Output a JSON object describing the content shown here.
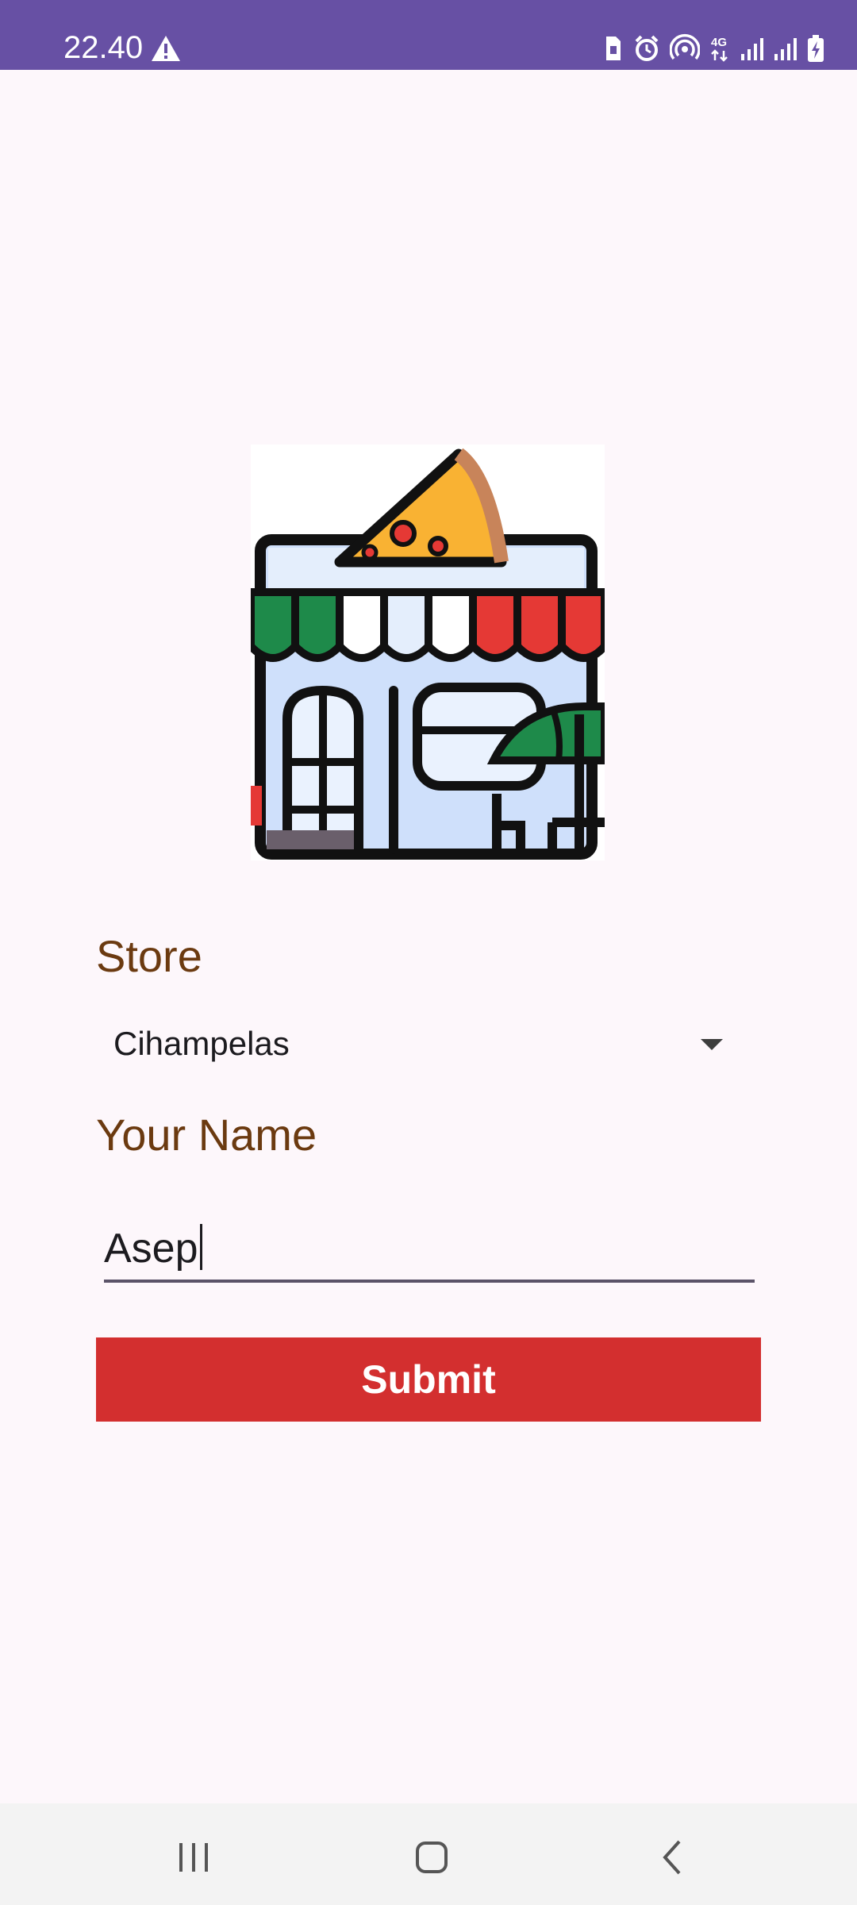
{
  "status_bar": {
    "time": "22.40",
    "icons": [
      "warning-icon",
      "sim-icon",
      "alarm-icon",
      "hotspot-icon",
      "4g-icon",
      "signal-icon",
      "signal-icon",
      "battery-charging-icon"
    ],
    "network": "4G",
    "background_color": "#6750a4"
  },
  "store_image": {
    "icon": "pizza-store-icon"
  },
  "form": {
    "store_label": "Store",
    "store_selected": "Cihampelas",
    "name_label": "Your Name",
    "name_value": "Asep",
    "submit_label": "Submit"
  },
  "colors": {
    "label": "#6b3a10",
    "submit_button": "#d32f2f",
    "background": "#fdf7fb"
  },
  "nav_bar": {
    "buttons": [
      "recent-apps-icon",
      "home-icon",
      "back-icon"
    ]
  }
}
